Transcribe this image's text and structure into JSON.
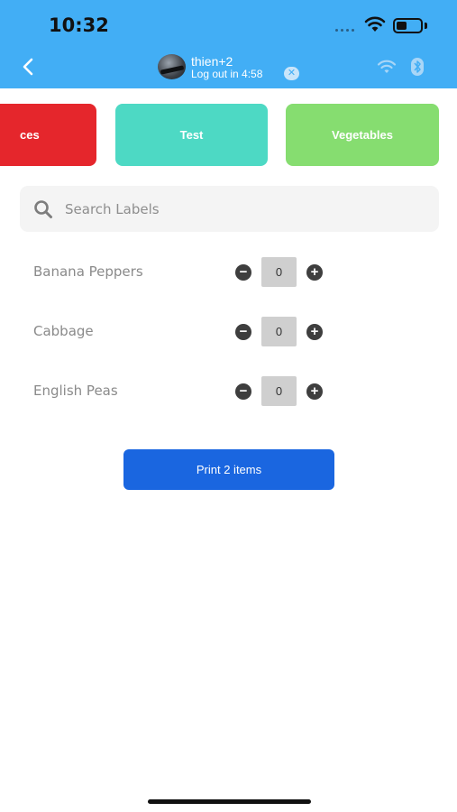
{
  "status_bar": {
    "time": "10:32"
  },
  "header": {
    "user_name": "thien+2",
    "logout_text": "Log out in 4:58",
    "logout_close_glyph": "✕",
    "icons": [
      "back-chevron-icon",
      "avatar",
      "wifi-icon",
      "bluetooth-icon"
    ]
  },
  "categories": [
    {
      "label": "ces",
      "color": "#e5262c"
    },
    {
      "label": "Test",
      "color": "#4dd9c4"
    },
    {
      "label": "Vegetables",
      "color": "#86dd70"
    }
  ],
  "search": {
    "placeholder": "Search Labels",
    "value": ""
  },
  "items": [
    {
      "name": "Banana Peppers",
      "quantity": "0",
      "minus": "−",
      "plus": "+"
    },
    {
      "name": "Cabbage",
      "quantity": "0",
      "minus": "−",
      "plus": "+"
    },
    {
      "name": "English Peas",
      "quantity": "0",
      "minus": "−",
      "plus": "+"
    }
  ],
  "print_button": {
    "label": "Print 2 items",
    "color": "#1a66e0"
  },
  "colors": {
    "header": "#42aef5"
  }
}
